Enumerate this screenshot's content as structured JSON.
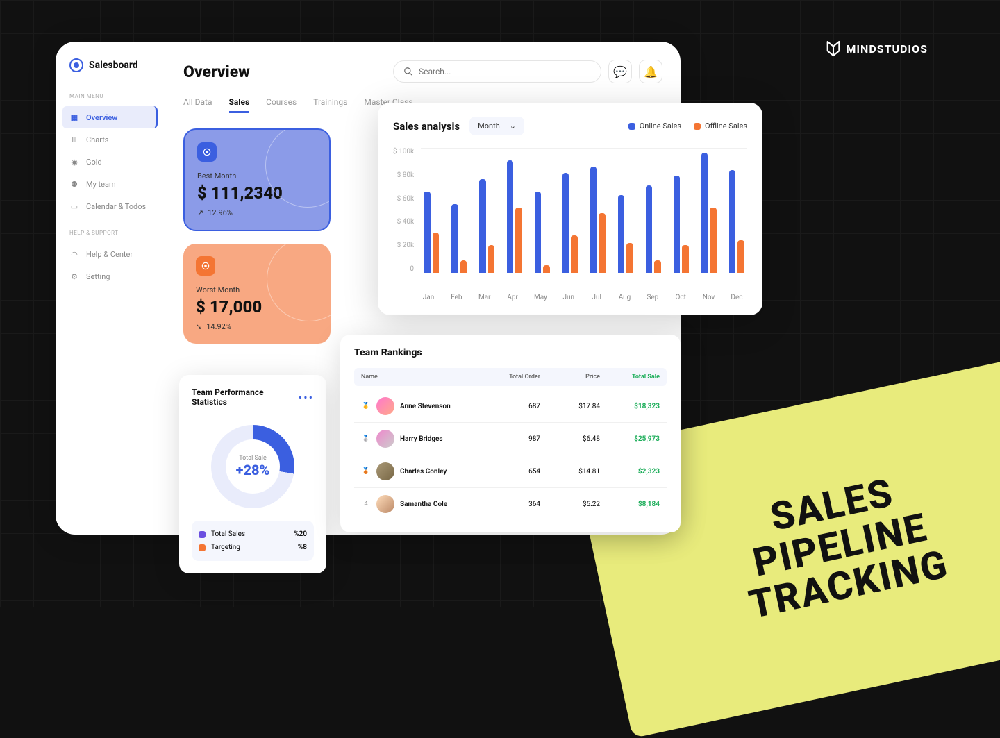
{
  "brand": "MINDSTUDIOS",
  "sticker": "SALES\nPIPELINE\nTRACKING",
  "app": {
    "name": "Salesboard",
    "page_title": "Overview",
    "search_placeholder": "Search...",
    "sidebar": {
      "section1_label": "MAIN MENU",
      "section2_label": "HELP & SUPPORT",
      "items1": [
        "Overview",
        "Charts",
        "Gold",
        "My team",
        "Calendar & Todos"
      ],
      "items2": [
        "Help & Center",
        "Setting"
      ],
      "active": "Overview"
    },
    "tabs": [
      "All Data",
      "Sales",
      "Courses",
      "Trainings",
      "Master Class"
    ],
    "active_tab": "Sales",
    "kpi_best": {
      "label": "Best Month",
      "value": "$ 111,2340",
      "delta": "12.96%"
    },
    "kpi_worst": {
      "label": "Worst Month",
      "value": "$ 17,000",
      "delta": "14.92%"
    }
  },
  "team_perf": {
    "title": "Team Performance Statistics",
    "donut_label": "Total Sale",
    "donut_value": "+28%",
    "rows": [
      {
        "label": "Total Sales",
        "value": "%20",
        "color": "#6B4FE0"
      },
      {
        "label": "Targeting",
        "value": "%8",
        "color": "#F47533"
      }
    ]
  },
  "sales_chart": {
    "title": "Sales analysis",
    "period": "Month",
    "legend": [
      {
        "label": "Online Sales",
        "color": "#3B5FE0"
      },
      {
        "label": "Offline Sales",
        "color": "#F47533"
      }
    ]
  },
  "rankings": {
    "title": "Team Rankings",
    "headers": [
      "Name",
      "Total Order",
      "Price",
      "Total Sale"
    ],
    "rows": [
      {
        "rank": "1",
        "name": "Anne Stevenson",
        "orders": "687",
        "price": "$17.84",
        "total": "$18,323"
      },
      {
        "rank": "2",
        "name": "Harry Bridges",
        "orders": "987",
        "price": "$6.48",
        "total": "$25,973"
      },
      {
        "rank": "3",
        "name": "Charles Conley",
        "orders": "654",
        "price": "$14.81",
        "total": "$2,323"
      },
      {
        "rank": "4",
        "name": "Samantha Cole",
        "orders": "364",
        "price": "$5.22",
        "total": "$8,184"
      }
    ]
  },
  "chart_data": {
    "type": "bar",
    "title": "Sales analysis",
    "ylabel": "$",
    "ylim": [
      0,
      100
    ],
    "y_ticks": [
      "$ 100k",
      "$ 80k",
      "$ 60k",
      "$ 40k",
      "$ 20k",
      "0"
    ],
    "categories": [
      "Jan",
      "Feb",
      "Mar",
      "Apr",
      "May",
      "Jun",
      "Jul",
      "Aug",
      "Sep",
      "Oct",
      "Nov",
      "Dec"
    ],
    "series": [
      {
        "name": "Online Sales",
        "color": "#3B5FE0",
        "values": [
          65,
          55,
          75,
          90,
          65,
          80,
          85,
          62,
          70,
          78,
          96,
          82
        ]
      },
      {
        "name": "Offline Sales",
        "color": "#F47533",
        "values": [
          32,
          10,
          22,
          52,
          6,
          30,
          48,
          24,
          10,
          22,
          52,
          26
        ]
      }
    ]
  }
}
